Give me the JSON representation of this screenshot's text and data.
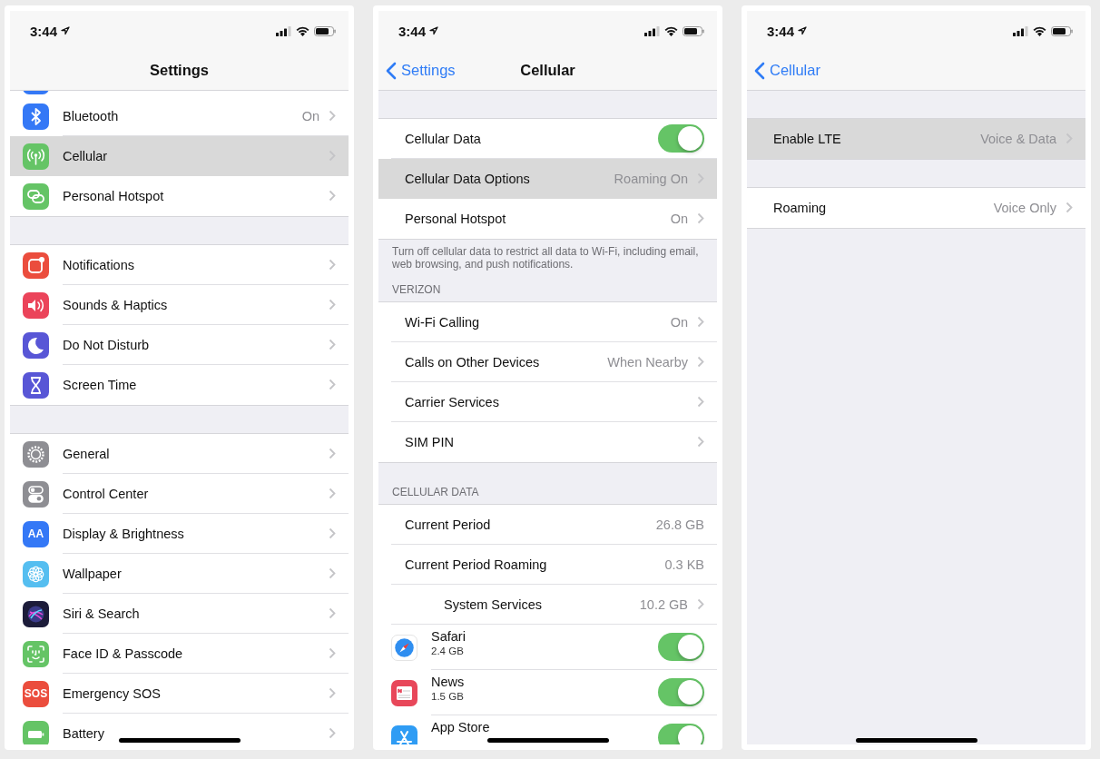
{
  "screens": [
    {
      "status": {
        "time": "3:44"
      },
      "nav": {
        "title": "Settings"
      },
      "sections": [
        {
          "rows": [
            {
              "kind": "link",
              "color": "#3478f6",
              "selected": false
            },
            {
              "kind": "link",
              "label": "Bluetooth",
              "value": "On",
              "color": "#3478f6",
              "selected": false
            },
            {
              "kind": "link",
              "label": "Cellular",
              "color": "#65c466",
              "selected": true
            },
            {
              "kind": "link",
              "label": "Personal Hotspot",
              "color": "#65c466",
              "selected": false
            }
          ]
        },
        {
          "rows": [
            {
              "kind": "link",
              "label": "Notifications",
              "color": "#eb4d3d",
              "selected": false
            },
            {
              "kind": "link",
              "label": "Sounds & Haptics",
              "color": "#eb445a",
              "selected": false
            },
            {
              "kind": "link",
              "label": "Do Not Disturb",
              "color": "#5856d6",
              "selected": false
            },
            {
              "kind": "link",
              "label": "Screen Time",
              "color": "#5856d6",
              "selected": false
            }
          ]
        },
        {
          "rows": [
            {
              "kind": "link",
              "label": "General",
              "color": "#8e8e93",
              "selected": false
            },
            {
              "kind": "link",
              "label": "Control Center",
              "color": "#8e8e93",
              "selected": false
            },
            {
              "kind": "link",
              "label": "Display & Brightness",
              "color": "#3478f6",
              "icon_text": "AA",
              "selected": false
            },
            {
              "kind": "link",
              "label": "Wallpaper",
              "color": "#55bef0",
              "selected": false
            },
            {
              "kind": "link",
              "label": "Siri & Search",
              "color": "#1c1c3a",
              "selected": false
            },
            {
              "kind": "link",
              "label": "Face ID & Passcode",
              "color": "#65c466",
              "selected": false
            },
            {
              "kind": "link",
              "label": "Emergency SOS",
              "color": "#eb4d3d",
              "icon_text": "SOS",
              "selected": false
            },
            {
              "kind": "link",
              "label": "Battery",
              "color": "#65c466",
              "selected": false
            }
          ]
        }
      ]
    },
    {
      "status": {
        "time": "3:44"
      },
      "nav": {
        "back": "Settings",
        "title": "Cellular"
      },
      "sections": [
        {
          "rows": [
            {
              "kind": "toggle",
              "label": "Cellular Data",
              "on": true,
              "selected": false
            },
            {
              "kind": "link",
              "label": "Cellular Data Options",
              "value": "Roaming On",
              "selected": true
            },
            {
              "kind": "link",
              "label": "Personal Hotspot",
              "value": "On",
              "selected": false
            }
          ],
          "footer": "Turn off cellular data to restrict all data to Wi-Fi, including email, web browsing, and push notifications."
        },
        {
          "header": "VERIZON",
          "rows": [
            {
              "kind": "link",
              "label": "Wi-Fi Calling",
              "value": "On",
              "selected": false
            },
            {
              "kind": "link",
              "label": "Calls on Other Devices",
              "value": "When Nearby",
              "selected": false
            },
            {
              "kind": "link",
              "label": "Carrier Services",
              "selected": false
            },
            {
              "kind": "link",
              "label": "SIM PIN",
              "selected": false
            }
          ]
        },
        {
          "header": "CELLULAR DATA",
          "rows": [
            {
              "kind": "info",
              "label": "Current Period",
              "value": "26.8 GB",
              "selected": false
            },
            {
              "kind": "info",
              "label": "Current Period Roaming",
              "value": "0.3 KB",
              "selected": false
            },
            {
              "kind": "link",
              "label": "System Services",
              "value": "10.2 GB",
              "indented": true,
              "selected": false
            },
            {
              "kind": "app",
              "label": "Safari",
              "sub": "2.4 GB",
              "color": "#ffffff",
              "on": true,
              "selected": false
            },
            {
              "kind": "app",
              "label": "News",
              "sub": "1.5 GB",
              "color": "#e8475a",
              "on": true,
              "selected": false
            },
            {
              "kind": "app",
              "label": "App Store",
              "color": "#2f9cf4",
              "on": true,
              "selected": false
            }
          ]
        }
      ]
    },
    {
      "status": {
        "time": "3:44"
      },
      "nav": {
        "back": "Cellular"
      },
      "sections": [
        {
          "rows": [
            {
              "kind": "link",
              "label": "Enable LTE",
              "value": "Voice & Data",
              "selected": true
            }
          ]
        },
        {
          "rows": [
            {
              "kind": "link",
              "label": "Roaming",
              "value": "Voice Only",
              "selected": false
            }
          ]
        }
      ]
    }
  ]
}
